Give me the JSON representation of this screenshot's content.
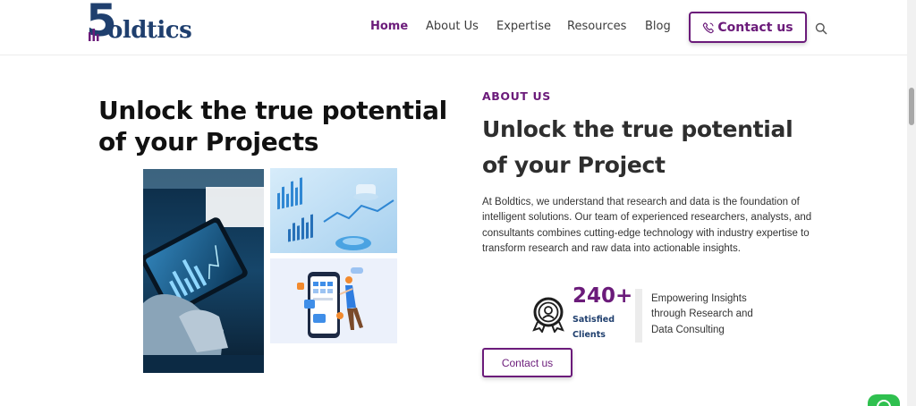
{
  "header": {
    "logo": {
      "mark": "5",
      "word": "oldtics",
      "alt_text": "Boldtics"
    },
    "nav": [
      {
        "label": "Home",
        "active": true
      },
      {
        "label": "About Us",
        "active": false
      },
      {
        "label": "Expertise",
        "active": false
      },
      {
        "label": "Resources",
        "active": false
      },
      {
        "label": "Blog",
        "active": false
      }
    ],
    "contact_button": {
      "label": "Contact us",
      "icon": "phone-icon"
    },
    "search_icon": "search-icon"
  },
  "hero": {
    "heading": "Unlock the true potential of your Projects",
    "images": [
      {
        "name": "tablet-analytics-photo"
      },
      {
        "name": "analytics-charts-photo"
      },
      {
        "name": "mobile-app-illustration"
      }
    ]
  },
  "about": {
    "label": "ABOUT US",
    "heading": "Unlock the true potential of your Project",
    "body": "At Boldtics, we understand that research and data is the foundation of intelligent solutions. Our team of experienced researchers, analysts, and consultants combines cutting-edge technology with industry expertise to transform research and raw data into actionable insights.",
    "stat": {
      "number": "240+",
      "label": "Satisfied Clients",
      "icon": "award-badge-icon",
      "description": "Empowering Insights through Research and Data Consulting"
    },
    "button_label": "Contact us"
  },
  "colors": {
    "brand_purple": "#6b1b7a",
    "brand_navy": "#1f3f6e",
    "whatsapp_green": "#2fc04f"
  }
}
